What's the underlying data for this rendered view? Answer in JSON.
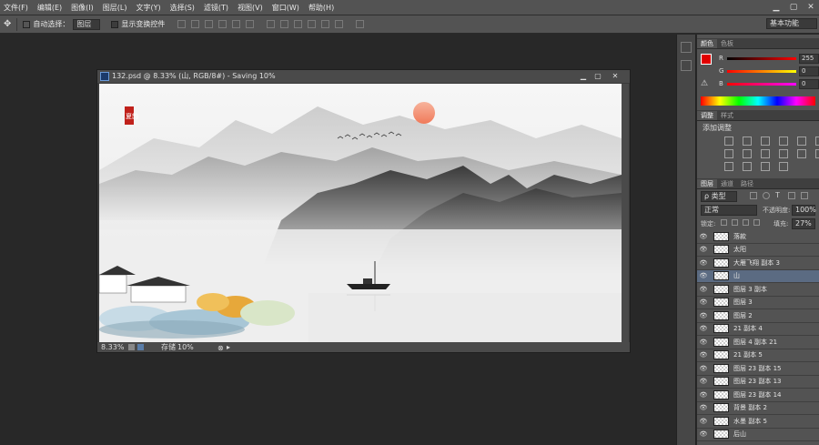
{
  "menubar": {
    "items": [
      "文件(F)",
      "编辑(E)",
      "图像(I)",
      "图层(L)",
      "文字(Y)",
      "选择(S)",
      "滤镜(T)",
      "视图(V)",
      "窗口(W)",
      "帮助(H)"
    ],
    "minimize": "▁",
    "maximize": "▢",
    "close": "✕"
  },
  "options": {
    "auto_select_label": "自动选择：",
    "auto_select_value": "图层",
    "show_transform_label": "显示变换控件",
    "workspace_value": "基本功能"
  },
  "document": {
    "title": "132.psd @ 8.33% (山, RGB/8#) - Saving 10%",
    "zoom": "8.33%",
    "status_label": "存储",
    "status_value": "10%",
    "stamp_text": "夏韵"
  },
  "color_panel": {
    "tabs": [
      "颜色",
      "色板"
    ],
    "fg_color": "#e10000",
    "channels": [
      {
        "label": "R",
        "value": "255",
        "from": "#000000",
        "to": "#ff0000"
      },
      {
        "label": "G",
        "value": "0",
        "from": "#ff0000",
        "to": "#ffff00"
      },
      {
        "label": "B",
        "value": "0",
        "from": "#ff0000",
        "to": "#ff00ff"
      }
    ]
  },
  "adjust_panel": {
    "tabs": [
      "调整",
      "样式"
    ],
    "heading": "添加调整"
  },
  "layers_panel": {
    "tabs": [
      "图层",
      "通道",
      "路径"
    ],
    "kind_label": "ρ 类型",
    "blend_mode": "正常",
    "opacity_label": "不透明度:",
    "opacity_value": "100%",
    "lock_label": "锁定:",
    "fill_label": "填充:",
    "fill_value": "27%",
    "layers": [
      {
        "name": "落款",
        "selected": false
      },
      {
        "name": "太阳",
        "selected": false
      },
      {
        "name": "大雁飞翔 副本 3",
        "selected": false
      },
      {
        "name": "山",
        "selected": true
      },
      {
        "name": "图层 3 副本",
        "selected": false
      },
      {
        "name": "图层 3",
        "selected": false
      },
      {
        "name": "图层 2",
        "selected": false
      },
      {
        "name": "21 副本 4",
        "selected": false
      },
      {
        "name": "图层 4 副本 21",
        "selected": false
      },
      {
        "name": "21 副本 5",
        "selected": false
      },
      {
        "name": "图层 23 副本 15",
        "selected": false
      },
      {
        "name": "图层 23 副本 13",
        "selected": false
      },
      {
        "name": "图层 23 副本 14",
        "selected": false
      },
      {
        "name": "背景 副本 2",
        "selected": false
      },
      {
        "name": "水墨 副本 5",
        "selected": false
      },
      {
        "name": "后山",
        "selected": false
      }
    ]
  }
}
